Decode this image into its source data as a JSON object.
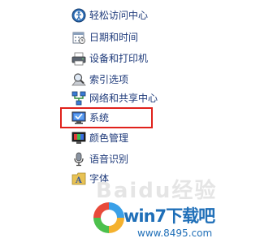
{
  "control_panel_items": [
    {
      "label": "轻松访问中心",
      "icon": "ease-of-access-icon"
    },
    {
      "label": "日期和时间",
      "icon": "date-time-icon"
    },
    {
      "label": "设备和打印机",
      "icon": "printer-icon"
    },
    {
      "label": "索引选项",
      "icon": "indexing-icon"
    },
    {
      "label": "网络和共享中心",
      "icon": "network-icon"
    },
    {
      "label": "系统",
      "icon": "system-icon"
    },
    {
      "label": "颜色管理",
      "icon": "color-management-icon"
    },
    {
      "label": "语音识别",
      "icon": "speech-recognition-icon"
    },
    {
      "label": "字体",
      "icon": "fonts-icon"
    }
  ],
  "highlighted_item": "系统",
  "highlight_color": "#e0211b",
  "link_color": "#1e3a7a",
  "watermark": {
    "brand": "win7下载吧",
    "url": "www.8495.com",
    "background_text": "Baidu经验",
    "brand_color": "#1f6fb8"
  }
}
